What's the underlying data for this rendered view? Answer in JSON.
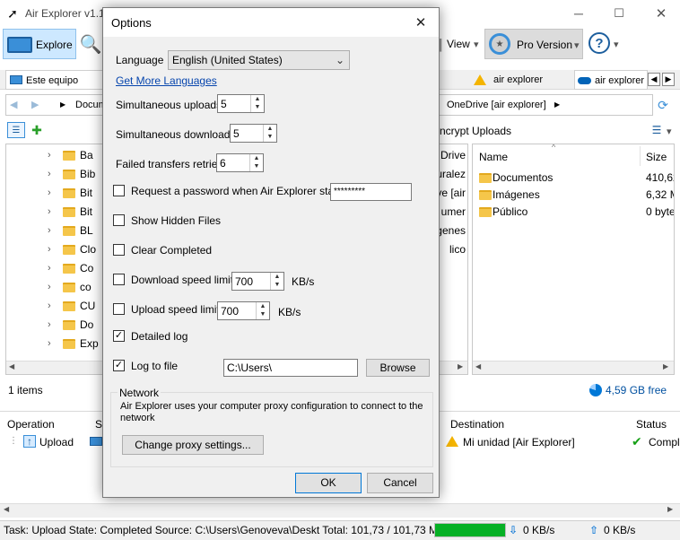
{
  "app": {
    "title": "Air Explorer v1.1",
    "toolbar": {
      "explore_label": "Explore",
      "view_label": "View",
      "pro_label": "Pro Version"
    },
    "tabs": [
      {
        "label": "Este equipo"
      },
      {
        "label": "r"
      },
      {
        "label": "air explorer"
      },
      {
        "label": "air explorer"
      }
    ],
    "left_path": "Docum",
    "right_path": "OneDrive [air explorer]",
    "right_header_caption": "ncrypt Uploads",
    "left_tree": [
      "Ba",
      "Bib",
      "Bit",
      "Bit",
      "BL",
      "Clo",
      "Co",
      "co",
      "CU",
      "Do",
      "Exp"
    ],
    "middle_fragments": [
      "Drive",
      "uralez",
      "ve [air",
      "umer",
      "genes",
      "lico"
    ],
    "right_columns": {
      "name": "Name",
      "size": "Size"
    },
    "right_files": [
      {
        "name": "Documentos",
        "size": "410,62"
      },
      {
        "name": "Imágenes",
        "size": "6,32 M"
      },
      {
        "name": "Público",
        "size": "0 byte"
      }
    ],
    "left_status": "1 items",
    "free_space": "4,59 GB free",
    "queue": {
      "col_operation": "Operation",
      "col_source_fragment": "So",
      "col_destination": "Destination",
      "col_status": "Status",
      "row_operation": "Upload",
      "row_destination": "Mi unidad [Air Explorer]",
      "row_status": "Comple"
    },
    "statusbar": {
      "task": "Task: Upload State: Completed Source: C:\\Users\\Genoveva\\Deskt Total: 101,73 / 101,73 MB",
      "progress": 1.0,
      "download_speed": "0 KB/s",
      "upload_speed": "0 KB/s"
    }
  },
  "dialog": {
    "title": "Options",
    "close_glyph": "✕",
    "language_label": "Language",
    "language_value": "English (United States)",
    "more_languages_link": "Get More Languages",
    "simultaneous_uploads_label": "Simultaneous uploads",
    "simultaneous_uploads_value": "5",
    "simultaneous_downloads_label": "Simultaneous downloads",
    "simultaneous_downloads_value": "5",
    "failed_retries_label": "Failed transfers retries",
    "failed_retries_value": "6",
    "request_password_label": "Request a password when Air Explorer starts",
    "password_value": "*********",
    "show_hidden_label": "Show Hidden Files",
    "clear_completed_label": "Clear Completed",
    "download_limit_label": "Download speed limit",
    "download_limit_value": "700",
    "download_limit_unit": "KB/s",
    "upload_limit_label": "Upload speed limit",
    "upload_limit_value": "700",
    "upload_limit_unit": "KB/s",
    "detailed_log_label": "Detailed log",
    "log_to_file_label": "Log to file",
    "log_path_value": "C:\\Users\\",
    "browse_label": "Browse",
    "network_group_label": "Network",
    "network_text": "Air Explorer uses your computer proxy configuration to connect to the network",
    "change_proxy_label": "Change proxy settings...",
    "ok_label": "OK",
    "cancel_label": "Cancel",
    "checkbox_states": {
      "request_password": false,
      "show_hidden": false,
      "clear_completed": false,
      "download_limit": false,
      "upload_limit": false,
      "detailed_log": true,
      "log_to_file": true
    }
  },
  "colors": {
    "accent_blue": "#0078d7",
    "link_blue": "#0645ad",
    "progress_green": "#06b025",
    "folder_yellow": "#f5c64a"
  }
}
